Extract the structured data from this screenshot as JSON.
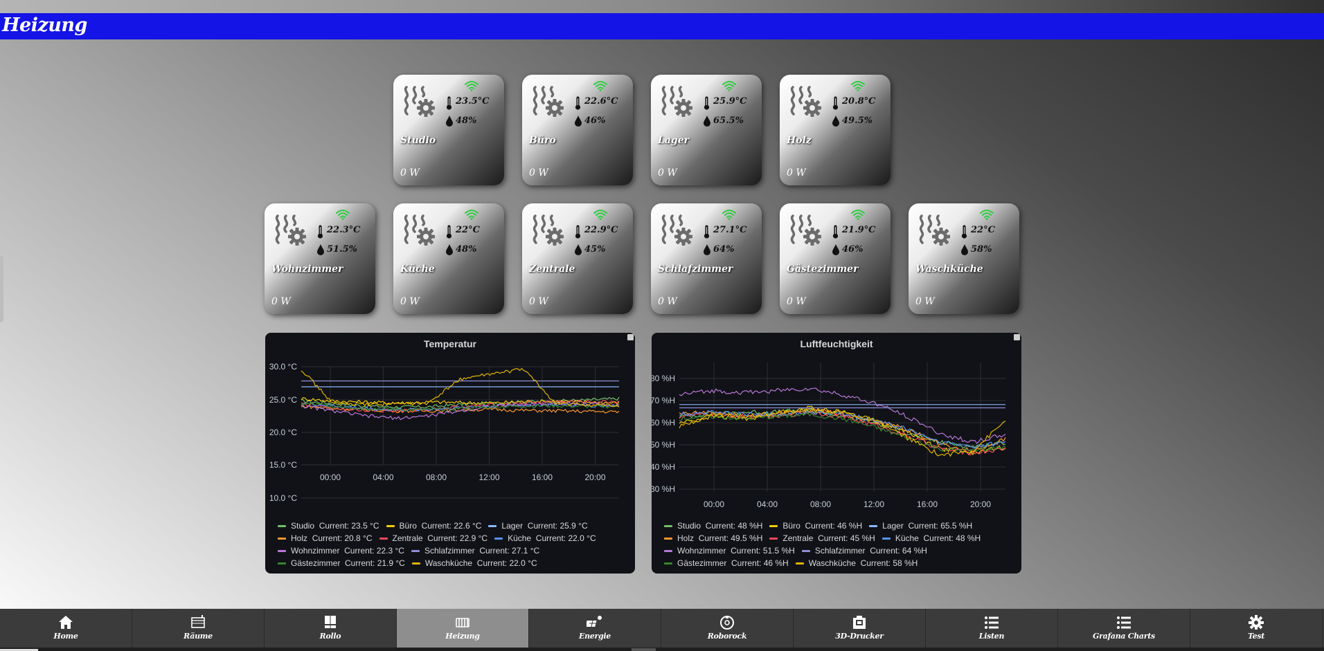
{
  "header": {
    "title": "Heizung"
  },
  "tiles": [
    {
      "name": "Studio",
      "temp": "23.5°C",
      "humidity": "48%",
      "power": "0 W"
    },
    {
      "name": "Büro",
      "temp": "22.6°C",
      "humidity": "46%",
      "power": "0 W"
    },
    {
      "name": "Lager",
      "temp": "25.9°C",
      "humidity": "65.5%",
      "power": "0 W"
    },
    {
      "name": "Holz",
      "temp": "20.8°C",
      "humidity": "49.5%",
      "power": "0 W"
    },
    {
      "name": "Wohnzimmer",
      "temp": "22.3°C",
      "humidity": "51.5%",
      "power": "0 W"
    },
    {
      "name": "Küche",
      "temp": "22°C",
      "humidity": "48%",
      "power": "0 W"
    },
    {
      "name": "Zentrale",
      "temp": "22.9°C",
      "humidity": "45%",
      "power": "0 W"
    },
    {
      "name": "Schlafzimmer",
      "temp": "27.1°C",
      "humidity": "64%",
      "power": "0 W"
    },
    {
      "name": "Gästezimmer",
      "temp": "21.9°C",
      "humidity": "46%",
      "power": "0 W"
    },
    {
      "name": "Waschküche",
      "temp": "22°C",
      "humidity": "58%",
      "power": "0 W"
    }
  ],
  "colors": {
    "header_bar": "#1414e6",
    "wifi": "#2ecc40",
    "panel_bg": "#111217"
  },
  "chart_data": [
    {
      "type": "line",
      "title": "Temperatur",
      "ylim": [
        10,
        30
      ],
      "yticks": [
        "30.0 °C",
        "25.0 °C",
        "20.0 °C",
        "15.0 °C",
        "10.0 °C"
      ],
      "xticks": [
        "00:00",
        "04:00",
        "08:00",
        "12:00",
        "16:00",
        "20:00"
      ],
      "grid": true,
      "legend_position": "bottom",
      "series": [
        {
          "name": "Studio",
          "color": "#73bf69",
          "current": "Current: 23.5 °C",
          "values": [
            23,
            22.5,
            22,
            21.8,
            21.8,
            22.3,
            22.6,
            22.8,
            23,
            23.2,
            23.5
          ]
        },
        {
          "name": "Büro",
          "color": "#f2cc0c",
          "current": "Current: 22.6 °C",
          "values": [
            23.5,
            23,
            22.8,
            22.6,
            22.8,
            22.7,
            22.6,
            22.9,
            23,
            22.8,
            22.6
          ]
        },
        {
          "name": "Lager",
          "color": "#8ab8ff",
          "current": "Current: 25.9 °C",
          "values": [
            25.9,
            25.9,
            25.9,
            25.9,
            25.9,
            25.9,
            25.9,
            25.9,
            25.9,
            25.9,
            25.9
          ]
        },
        {
          "name": "Holz",
          "color": "#ff9830",
          "current": "Current: 20.8 °C",
          "values": [
            22,
            21.5,
            21.2,
            21,
            21,
            21.2,
            21.3,
            21.1,
            21,
            20.9,
            20.8
          ]
        },
        {
          "name": "Zentrale",
          "color": "#f2495c",
          "current": "Current: 22.9 °C",
          "values": [
            22.5,
            21.5,
            21.2,
            21,
            21.3,
            21.8,
            22.2,
            22.6,
            22.9,
            22.8,
            22.9
          ]
        },
        {
          "name": "Küche",
          "color": "#5794f2",
          "current": "Current: 22.0 °C",
          "values": [
            22.5,
            22,
            21.5,
            21.2,
            21.3,
            21.7,
            22,
            22.2,
            22.3,
            22.1,
            22
          ]
        },
        {
          "name": "Wohnzimmer",
          "color": "#b877d9",
          "current": "Current: 22.3 °C",
          "values": [
            22,
            21,
            20,
            19.5,
            20,
            21,
            22,
            22.2,
            22.5,
            22.4,
            22.3
          ]
        },
        {
          "name": "Schlafzimmer",
          "color": "#8f8fd9",
          "current": "Current: 27.1 °C",
          "values": [
            27.1,
            27.1,
            27.1,
            27.1,
            27.1,
            27.1,
            27.1,
            27.1,
            27.1,
            27.1,
            27.1
          ]
        },
        {
          "name": "Gästezimmer",
          "color": "#37872d",
          "current": "Current: 21.9 °C",
          "values": [
            22.5,
            22,
            21.5,
            21.3,
            21.2,
            21.5,
            21.8,
            22,
            22,
            21.9,
            21.9
          ]
        },
        {
          "name": "Waschküche",
          "color": "#e0b400",
          "current": "Current: 22.0 °C",
          "values": [
            29.5,
            22.5,
            22.3,
            22.5,
            22.5,
            27.5,
            28.5,
            29.5,
            22.5,
            22.2,
            22
          ]
        }
      ]
    },
    {
      "type": "line",
      "title": "Luftfeuchtigkeit",
      "ylim": [
        25,
        85
      ],
      "yticks": [
        "80 %H",
        "70 %H",
        "60 %H",
        "50 %H",
        "40 %H",
        "30 %H"
      ],
      "xticks": [
        "00:00",
        "04:00",
        "08:00",
        "12:00",
        "16:00",
        "20:00"
      ],
      "grid": true,
      "legend_position": "bottom",
      "series": [
        {
          "name": "Studio",
          "color": "#73bf69",
          "current": "Current: 48 %H",
          "values": [
            60,
            61,
            62,
            62,
            63,
            60,
            57,
            52,
            48,
            46,
            48
          ]
        },
        {
          "name": "Büro",
          "color": "#f2cc0c",
          "current": "Current: 46 %H",
          "values": [
            57,
            60,
            59,
            61,
            64,
            62,
            58,
            53,
            45,
            43,
            46
          ]
        },
        {
          "name": "Lager",
          "color": "#8ab8ff",
          "current": "Current: 65.5 %H",
          "values": [
            65.5,
            65.5,
            65.5,
            65.5,
            65.5,
            65.5,
            65.5,
            65.5,
            65.5,
            65.5,
            65.5
          ]
        },
        {
          "name": "Holz",
          "color": "#ff9830",
          "current": "Current: 49.5 %H",
          "values": [
            61,
            62,
            60,
            61,
            63,
            61,
            58,
            54,
            47,
            44,
            49.5
          ]
        },
        {
          "name": "Zentrale",
          "color": "#f2495c",
          "current": "Current: 45 %H",
          "values": [
            60,
            61,
            60,
            60,
            62,
            60,
            56,
            51,
            45,
            43,
            45
          ]
        },
        {
          "name": "Küche",
          "color": "#5794f2",
          "current": "Current: 48 %H",
          "values": [
            61,
            62,
            61,
            61,
            62,
            61,
            58,
            54,
            48,
            46,
            48
          ]
        },
        {
          "name": "Wohnzimmer",
          "color": "#b877d9",
          "current": "Current: 51.5 %H",
          "values": [
            70,
            72,
            71,
            72,
            73,
            70,
            66,
            60,
            52,
            48,
            51.5
          ]
        },
        {
          "name": "Schlafzimmer",
          "color": "#8f8fd9",
          "current": "Current: 64 %H",
          "values": [
            64,
            64,
            64,
            64,
            64,
            64,
            64,
            64,
            64,
            64,
            64
          ]
        },
        {
          "name": "Gästezimmer",
          "color": "#37872d",
          "current": "Current: 46 %H",
          "values": [
            59,
            60,
            59,
            60,
            61,
            59,
            55,
            50,
            45,
            44,
            46
          ]
        },
        {
          "name": "Waschküche",
          "color": "#e0b400",
          "current": "Current: 58 %H",
          "values": [
            55,
            61,
            60,
            62,
            63,
            62,
            58,
            50,
            42,
            44,
            58
          ]
        }
      ]
    }
  ],
  "nav": [
    {
      "label": "Home",
      "icon": "home-icon",
      "active": false
    },
    {
      "label": "Räume",
      "icon": "frame-icon",
      "active": false
    },
    {
      "label": "Rollo",
      "icon": "blind-icon",
      "active": false
    },
    {
      "label": "Heizung",
      "icon": "radiator-icon",
      "active": true
    },
    {
      "label": "Energie",
      "icon": "solar-icon",
      "active": false
    },
    {
      "label": "Roborock",
      "icon": "robot-vacuum-icon",
      "active": false
    },
    {
      "label": "3D-Drucker",
      "icon": "printer-icon",
      "active": false
    },
    {
      "label": "Listen",
      "icon": "list-icon",
      "active": false
    },
    {
      "label": "Grafana Charts",
      "icon": "list-icon",
      "active": false
    },
    {
      "label": "Test",
      "icon": "gear-icon",
      "active": false
    }
  ]
}
